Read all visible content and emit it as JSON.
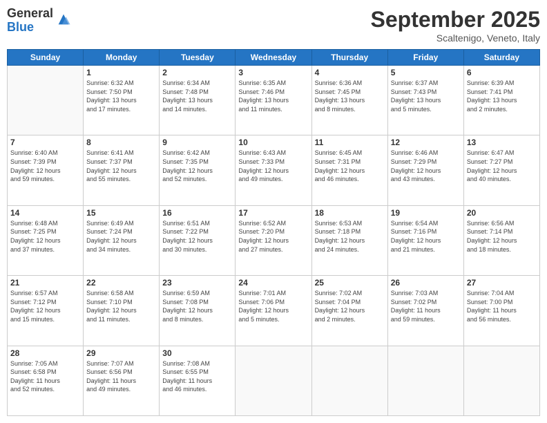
{
  "header": {
    "logo_general": "General",
    "logo_blue": "Blue",
    "month": "September 2025",
    "location": "Scaltenigo, Veneto, Italy"
  },
  "weekdays": [
    "Sunday",
    "Monday",
    "Tuesday",
    "Wednesday",
    "Thursday",
    "Friday",
    "Saturday"
  ],
  "weeks": [
    [
      {
        "day": "",
        "info": ""
      },
      {
        "day": "1",
        "info": "Sunrise: 6:32 AM\nSunset: 7:50 PM\nDaylight: 13 hours\nand 17 minutes."
      },
      {
        "day": "2",
        "info": "Sunrise: 6:34 AM\nSunset: 7:48 PM\nDaylight: 13 hours\nand 14 minutes."
      },
      {
        "day": "3",
        "info": "Sunrise: 6:35 AM\nSunset: 7:46 PM\nDaylight: 13 hours\nand 11 minutes."
      },
      {
        "day": "4",
        "info": "Sunrise: 6:36 AM\nSunset: 7:45 PM\nDaylight: 13 hours\nand 8 minutes."
      },
      {
        "day": "5",
        "info": "Sunrise: 6:37 AM\nSunset: 7:43 PM\nDaylight: 13 hours\nand 5 minutes."
      },
      {
        "day": "6",
        "info": "Sunrise: 6:39 AM\nSunset: 7:41 PM\nDaylight: 13 hours\nand 2 minutes."
      }
    ],
    [
      {
        "day": "7",
        "info": "Sunrise: 6:40 AM\nSunset: 7:39 PM\nDaylight: 12 hours\nand 59 minutes."
      },
      {
        "day": "8",
        "info": "Sunrise: 6:41 AM\nSunset: 7:37 PM\nDaylight: 12 hours\nand 55 minutes."
      },
      {
        "day": "9",
        "info": "Sunrise: 6:42 AM\nSunset: 7:35 PM\nDaylight: 12 hours\nand 52 minutes."
      },
      {
        "day": "10",
        "info": "Sunrise: 6:43 AM\nSunset: 7:33 PM\nDaylight: 12 hours\nand 49 minutes."
      },
      {
        "day": "11",
        "info": "Sunrise: 6:45 AM\nSunset: 7:31 PM\nDaylight: 12 hours\nand 46 minutes."
      },
      {
        "day": "12",
        "info": "Sunrise: 6:46 AM\nSunset: 7:29 PM\nDaylight: 12 hours\nand 43 minutes."
      },
      {
        "day": "13",
        "info": "Sunrise: 6:47 AM\nSunset: 7:27 PM\nDaylight: 12 hours\nand 40 minutes."
      }
    ],
    [
      {
        "day": "14",
        "info": "Sunrise: 6:48 AM\nSunset: 7:25 PM\nDaylight: 12 hours\nand 37 minutes."
      },
      {
        "day": "15",
        "info": "Sunrise: 6:49 AM\nSunset: 7:24 PM\nDaylight: 12 hours\nand 34 minutes."
      },
      {
        "day": "16",
        "info": "Sunrise: 6:51 AM\nSunset: 7:22 PM\nDaylight: 12 hours\nand 30 minutes."
      },
      {
        "day": "17",
        "info": "Sunrise: 6:52 AM\nSunset: 7:20 PM\nDaylight: 12 hours\nand 27 minutes."
      },
      {
        "day": "18",
        "info": "Sunrise: 6:53 AM\nSunset: 7:18 PM\nDaylight: 12 hours\nand 24 minutes."
      },
      {
        "day": "19",
        "info": "Sunrise: 6:54 AM\nSunset: 7:16 PM\nDaylight: 12 hours\nand 21 minutes."
      },
      {
        "day": "20",
        "info": "Sunrise: 6:56 AM\nSunset: 7:14 PM\nDaylight: 12 hours\nand 18 minutes."
      }
    ],
    [
      {
        "day": "21",
        "info": "Sunrise: 6:57 AM\nSunset: 7:12 PM\nDaylight: 12 hours\nand 15 minutes."
      },
      {
        "day": "22",
        "info": "Sunrise: 6:58 AM\nSunset: 7:10 PM\nDaylight: 12 hours\nand 11 minutes."
      },
      {
        "day": "23",
        "info": "Sunrise: 6:59 AM\nSunset: 7:08 PM\nDaylight: 12 hours\nand 8 minutes."
      },
      {
        "day": "24",
        "info": "Sunrise: 7:01 AM\nSunset: 7:06 PM\nDaylight: 12 hours\nand 5 minutes."
      },
      {
        "day": "25",
        "info": "Sunrise: 7:02 AM\nSunset: 7:04 PM\nDaylight: 12 hours\nand 2 minutes."
      },
      {
        "day": "26",
        "info": "Sunrise: 7:03 AM\nSunset: 7:02 PM\nDaylight: 11 hours\nand 59 minutes."
      },
      {
        "day": "27",
        "info": "Sunrise: 7:04 AM\nSunset: 7:00 PM\nDaylight: 11 hours\nand 56 minutes."
      }
    ],
    [
      {
        "day": "28",
        "info": "Sunrise: 7:05 AM\nSunset: 6:58 PM\nDaylight: 11 hours\nand 52 minutes."
      },
      {
        "day": "29",
        "info": "Sunrise: 7:07 AM\nSunset: 6:56 PM\nDaylight: 11 hours\nand 49 minutes."
      },
      {
        "day": "30",
        "info": "Sunrise: 7:08 AM\nSunset: 6:55 PM\nDaylight: 11 hours\nand 46 minutes."
      },
      {
        "day": "",
        "info": ""
      },
      {
        "day": "",
        "info": ""
      },
      {
        "day": "",
        "info": ""
      },
      {
        "day": "",
        "info": ""
      }
    ]
  ]
}
